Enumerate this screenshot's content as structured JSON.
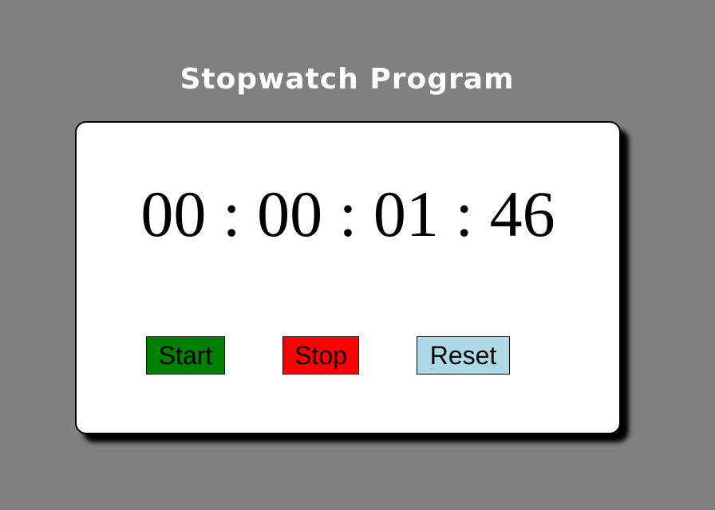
{
  "page": {
    "title": "Stopwatch Program",
    "background_color": "#808080"
  },
  "stopwatch": {
    "display": "00 : 00 : 01 : 46",
    "hours": "00",
    "minutes": "00",
    "seconds": "01",
    "hundredths": "46",
    "separator": ":"
  },
  "buttons": {
    "start": {
      "label": "Start",
      "color": "#008000"
    },
    "stop": {
      "label": "Stop",
      "color": "#ff0000"
    },
    "reset": {
      "label": "Reset",
      "color": "#add8e6"
    }
  }
}
